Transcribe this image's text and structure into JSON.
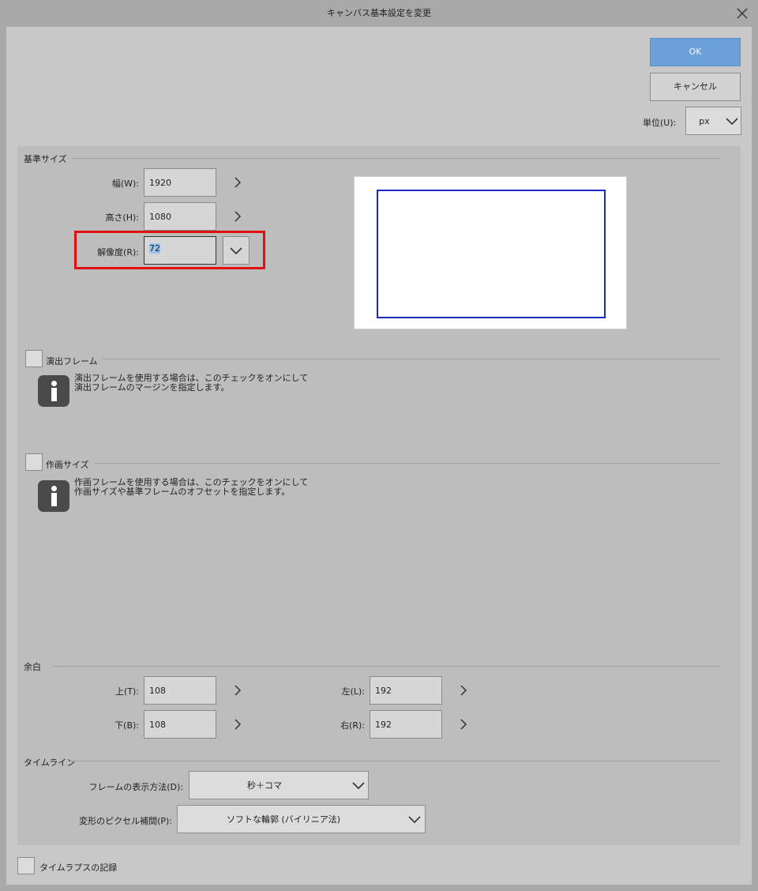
{
  "window": {
    "title": "キャンバス基本設定を変更"
  },
  "actions": {
    "ok_label": "OK",
    "cancel_label": "キャンセル",
    "unit_label": "単位(U):",
    "unit_value": "px"
  },
  "base_size": {
    "section_label": "基準サイズ",
    "width_label": "幅(W):",
    "width_value": "1920",
    "height_label": "高さ(H):",
    "height_value": "1080",
    "resolution_label": "解像度(R):",
    "resolution_value": "72"
  },
  "production_frame": {
    "section_label": "演出フレーム",
    "info_line1": "演出フレームを使用する場合は、このチェックをオンにして",
    "info_line2": "演出フレームのマージンを指定します。"
  },
  "drawing_size": {
    "section_label": "作画サイズ",
    "info_line1": "作画フレームを使用する場合は、このチェックをオンにして",
    "info_line2": "作画サイズや基準フレームのオフセットを指定します。"
  },
  "margin": {
    "section_label": "余白",
    "top_label": "上(T):",
    "top_value": "108",
    "bottom_label": "下(B):",
    "bottom_value": "108",
    "left_label": "左(L):",
    "left_value": "192",
    "right_label": "右(R):",
    "right_value": "192"
  },
  "timeline": {
    "section_label": "タイムライン",
    "frame_display_label": "フレームの表示方法(D):",
    "frame_display_value": "秒＋コマ",
    "interpolation_label": "変形のピクセル補間(P):",
    "interpolation_value": "ソフトな輪郭 (バイリニア法)"
  },
  "timelapse": {
    "label": "タイムラプスの記録"
  },
  "colors": {
    "accent": "#6ca0d8",
    "highlight": "#e01010",
    "preview_frame": "#1a28c8"
  }
}
